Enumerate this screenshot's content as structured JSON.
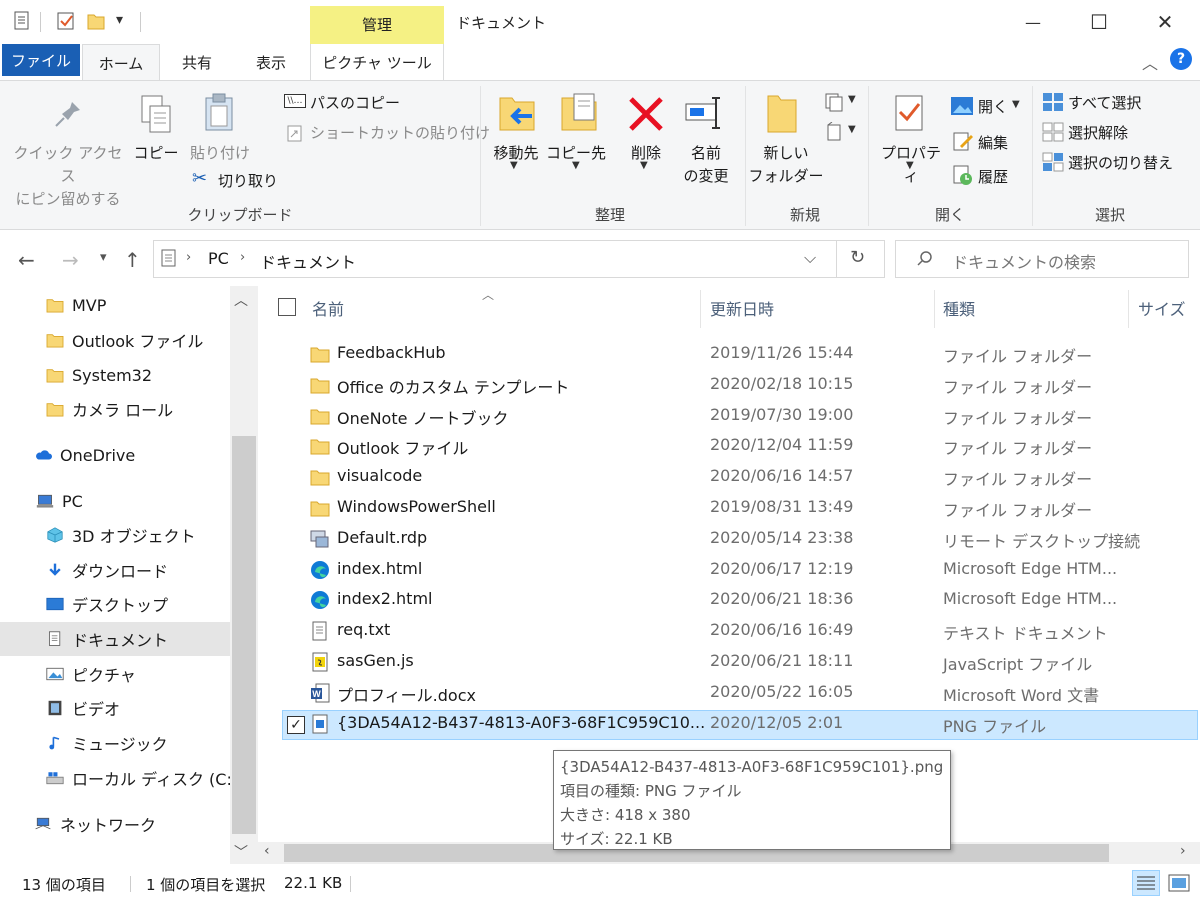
{
  "title_bar": {
    "contextual_tab_group": "管理",
    "window_title": "ドキュメント",
    "minimize_glyph": "—",
    "maximize_glyph": "☐",
    "close_glyph": "✕"
  },
  "tabs": {
    "file": "ファイル",
    "home": "ホーム",
    "share": "共有",
    "view": "表示",
    "picture_tools": "ピクチャ ツール"
  },
  "ribbon": {
    "clipboard": {
      "label": "クリップボード",
      "pin_line1": "クイック アクセス",
      "pin_line2": "にピン留めする",
      "copy": "コピー",
      "paste": "貼り付け",
      "copy_path": "パスのコピー",
      "paste_shortcut": "ショートカットの貼り付け",
      "cut": "切り取り"
    },
    "organize": {
      "label": "整理",
      "move_to": "移動先",
      "copy_to": "コピー先",
      "delete": "削除",
      "rename_line1": "名前",
      "rename_line2": "の変更"
    },
    "new": {
      "label": "新規",
      "new_folder_line1": "新しい",
      "new_folder_line2": "フォルダー"
    },
    "open": {
      "label": "開く",
      "properties": "プロパティ",
      "open": "開く",
      "edit": "編集",
      "history": "履歴"
    },
    "select": {
      "label": "選択",
      "select_all": "すべて選択",
      "select_none": "選択解除",
      "invert_selection": "選択の切り替え"
    }
  },
  "address": {
    "path": [
      "PC",
      "ドキュメント"
    ],
    "search_placeholder": "ドキュメントの検索"
  },
  "nav_pane": [
    {
      "label": "MVP",
      "icon": "folder-icon"
    },
    {
      "label": "Outlook ファイル",
      "icon": "folder-icon"
    },
    {
      "label": "System32",
      "icon": "folder-icon"
    },
    {
      "label": "カメラ ロール",
      "icon": "folder-icon"
    },
    {
      "label": "OneDrive",
      "icon": "onedrive-icon"
    },
    {
      "label": "PC",
      "icon": "pc-icon"
    },
    {
      "label": "3D オブジェクト",
      "icon": "3d-objects-icon"
    },
    {
      "label": "ダウンロード",
      "icon": "download-icon"
    },
    {
      "label": "デスクトップ",
      "icon": "desktop-icon"
    },
    {
      "label": "ドキュメント",
      "icon": "documents-icon"
    },
    {
      "label": "ピクチャ",
      "icon": "pictures-icon"
    },
    {
      "label": "ビデオ",
      "icon": "videos-icon"
    },
    {
      "label": "ミュージック",
      "icon": "music-icon"
    },
    {
      "label": "ローカル ディスク (C:)",
      "icon": "drive-icon"
    },
    {
      "label": "ネットワーク",
      "icon": "network-icon"
    }
  ],
  "columns": {
    "name": "名前",
    "date": "更新日時",
    "type": "種類",
    "size": "サイズ"
  },
  "files": [
    {
      "name": "FeedbackHub",
      "date": "2019/11/26 15:44",
      "type": "ファイル フォルダー",
      "icon": "folder-icon"
    },
    {
      "name": "Office のカスタム テンプレート",
      "date": "2020/02/18 10:15",
      "type": "ファイル フォルダー",
      "icon": "folder-icon"
    },
    {
      "name": "OneNote ノートブック",
      "date": "2019/07/30 19:00",
      "type": "ファイル フォルダー",
      "icon": "folder-icon"
    },
    {
      "name": "Outlook ファイル",
      "date": "2020/12/04 11:59",
      "type": "ファイル フォルダー",
      "icon": "folder-icon"
    },
    {
      "name": "visualcode",
      "date": "2020/06/16 14:57",
      "type": "ファイル フォルダー",
      "icon": "folder-icon"
    },
    {
      "name": "WindowsPowerShell",
      "date": "2019/08/31 13:49",
      "type": "ファイル フォルダー",
      "icon": "folder-icon"
    },
    {
      "name": "Default.rdp",
      "date": "2020/05/14 23:38",
      "type": "リモート デスクトップ接続",
      "icon": "rdp-file-icon"
    },
    {
      "name": "index.html",
      "date": "2020/06/17 12:19",
      "type": "Microsoft Edge HTM...",
      "icon": "edge-icon"
    },
    {
      "name": "index2.html",
      "date": "2020/06/21 18:36",
      "type": "Microsoft Edge HTM...",
      "icon": "edge-icon"
    },
    {
      "name": "req.txt",
      "date": "2020/06/16 16:49",
      "type": "テキスト ドキュメント",
      "icon": "text-file-icon"
    },
    {
      "name": "sasGen.js",
      "date": "2020/06/21 18:11",
      "type": "JavaScript ファイル",
      "icon": "js-file-icon"
    },
    {
      "name": "プロフィール.docx",
      "date": "2020/05/22 16:05",
      "type": "Microsoft Word 文書",
      "icon": "word-file-icon"
    },
    {
      "name": "{3DA54A12-B437-4813-A0F3-68F1C959C10...",
      "date": "2020/12/05 2:01",
      "type": "PNG ファイル",
      "icon": "png-file-icon"
    }
  ],
  "tooltip": {
    "line1": "{3DA54A12-B437-4813-A0F3-68F1C959C101}.png",
    "line2": "項目の種類: PNG ファイル",
    "line3": "大きさ: 418 x 380",
    "line4": "サイズ: 22.1 KB"
  },
  "status": {
    "item_count": "13 個の項目",
    "selected": "1 個の項目を選択",
    "selected_size": "22.1 KB"
  },
  "colors": {
    "accent": "#1a5fb4",
    "manage_tab": "#f5f184",
    "selection": "#cce8ff",
    "delete_red": "#e81123",
    "folder_yellow": "#f8d775"
  }
}
